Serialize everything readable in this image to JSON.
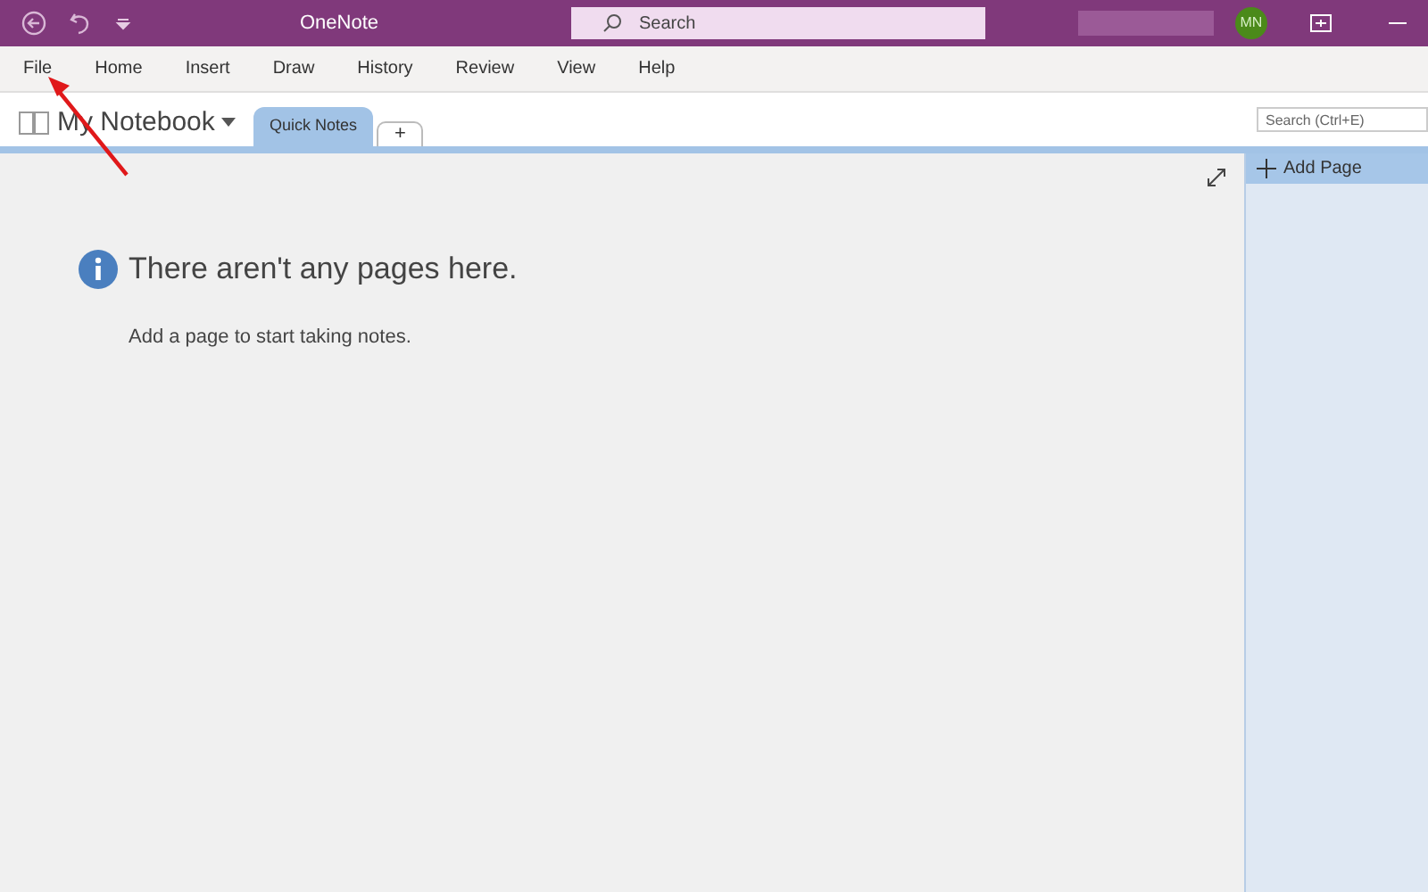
{
  "window": {
    "title": "OneNote"
  },
  "search": {
    "placeholder": "Search"
  },
  "account": {
    "initials": "MN"
  },
  "menu": [
    "File",
    "Home",
    "Insert",
    "Draw",
    "History",
    "Review",
    "View",
    "Help"
  ],
  "notebook": {
    "name": "My Notebook"
  },
  "sections": [
    {
      "label": "Quick Notes",
      "selected": true
    },
    {
      "label": "+",
      "selected": false
    }
  ],
  "page_search": {
    "placeholder": "Search (Ctrl+E)"
  },
  "empty": {
    "title": "There aren't any pages here.",
    "hint": "Add a page to start taking notes."
  },
  "pages_panel": {
    "add_page": "Add Page"
  }
}
